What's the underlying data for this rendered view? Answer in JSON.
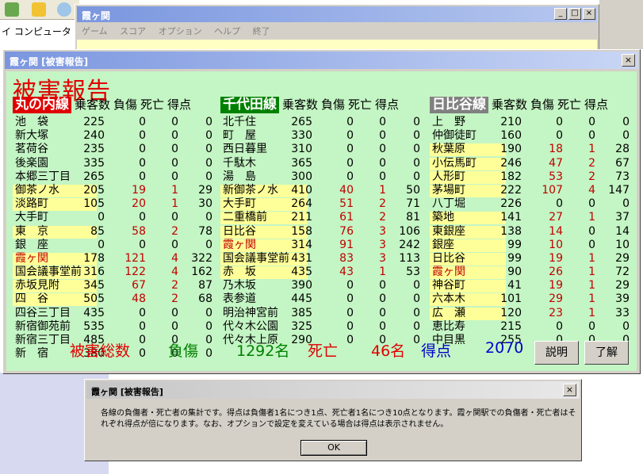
{
  "background": {
    "explorer_address": "イ コンピュータ",
    "game_title": "霞ヶ関",
    "game_menu": [
      "ゲーム",
      "スコア",
      "オプション",
      "ヘルプ",
      "終了"
    ],
    "window_buttons": {
      "minimize": "_",
      "maximize": "□",
      "close": "×"
    }
  },
  "dialog": {
    "title": "霞ヶ関 [被害報告]",
    "close": "×",
    "report_title": "被害報告",
    "column_headers": [
      "乗客数",
      "負傷",
      "死亡",
      "得点"
    ],
    "lines": [
      {
        "name": "丸の内線",
        "color": "#e00000",
        "stations": [
          {
            "name": "池　袋",
            "p": "225",
            "i": "0",
            "d": "0",
            "s": "0",
            "hl": false
          },
          {
            "name": "新大塚",
            "p": "240",
            "i": "0",
            "d": "0",
            "s": "0",
            "hl": false
          },
          {
            "name": "茗荷谷",
            "p": "235",
            "i": "0",
            "d": "0",
            "s": "0",
            "hl": false
          },
          {
            "name": "後楽園",
            "p": "335",
            "i": "0",
            "d": "0",
            "s": "0",
            "hl": false
          },
          {
            "name": "本郷三丁目",
            "p": "265",
            "i": "0",
            "d": "0",
            "s": "0",
            "hl": false
          },
          {
            "name": "御茶ノ水",
            "p": "205",
            "i": "19",
            "d": "1",
            "s": "29",
            "hl": true
          },
          {
            "name": "淡路町",
            "p": "105",
            "i": "20",
            "d": "1",
            "s": "30",
            "hl": true
          },
          {
            "name": "大手町",
            "p": "0",
            "i": "0",
            "d": "0",
            "s": "0",
            "hl": false
          },
          {
            "name": "東　京",
            "p": "85",
            "i": "58",
            "d": "2",
            "s": "78",
            "hl": true
          },
          {
            "name": "銀　座",
            "p": "0",
            "i": "0",
            "d": "0",
            "s": "0",
            "hl": false
          },
          {
            "name": "霞ヶ関",
            "p": "178",
            "i": "121",
            "d": "4",
            "s": "322",
            "hl": true,
            "red": true
          },
          {
            "name": "国会議事堂前",
            "p": "316",
            "i": "122",
            "d": "4",
            "s": "162",
            "hl": true
          },
          {
            "name": "赤坂見附",
            "p": "345",
            "i": "67",
            "d": "2",
            "s": "87",
            "hl": true
          },
          {
            "name": "四　谷",
            "p": "505",
            "i": "48",
            "d": "2",
            "s": "68",
            "hl": true
          },
          {
            "name": "四谷三丁目",
            "p": "435",
            "i": "0",
            "d": "0",
            "s": "0",
            "hl": false
          },
          {
            "name": "新宿御苑前",
            "p": "535",
            "i": "0",
            "d": "0",
            "s": "0",
            "hl": false
          },
          {
            "name": "新宿三丁目",
            "p": "485",
            "i": "0",
            "d": "0",
            "s": "0",
            "hl": false
          },
          {
            "name": "新　宿",
            "p": "380",
            "i": "0",
            "d": "0",
            "s": "0",
            "hl": false
          }
        ]
      },
      {
        "name": "千代田線",
        "color": "#008000",
        "stations": [
          {
            "name": "北千住",
            "p": "265",
            "i": "0",
            "d": "0",
            "s": "0",
            "hl": false
          },
          {
            "name": "町　屋",
            "p": "330",
            "i": "0",
            "d": "0",
            "s": "0",
            "hl": false
          },
          {
            "name": "西日暮里",
            "p": "310",
            "i": "0",
            "d": "0",
            "s": "0",
            "hl": false
          },
          {
            "name": "千駄木",
            "p": "365",
            "i": "0",
            "d": "0",
            "s": "0",
            "hl": false
          },
          {
            "name": "湯　島",
            "p": "300",
            "i": "0",
            "d": "0",
            "s": "0",
            "hl": false
          },
          {
            "name": "新御茶ノ水",
            "p": "410",
            "i": "40",
            "d": "1",
            "s": "50",
            "hl": true
          },
          {
            "name": "大手町",
            "p": "264",
            "i": "51",
            "d": "2",
            "s": "71",
            "hl": true
          },
          {
            "name": "二重橋前",
            "p": "211",
            "i": "61",
            "d": "2",
            "s": "81",
            "hl": true
          },
          {
            "name": "日比谷",
            "p": "158",
            "i": "76",
            "d": "3",
            "s": "106",
            "hl": true
          },
          {
            "name": "霞ヶ関",
            "p": "314",
            "i": "91",
            "d": "3",
            "s": "242",
            "hl": true,
            "red": true
          },
          {
            "name": "国会議事堂前",
            "p": "431",
            "i": "83",
            "d": "3",
            "s": "113",
            "hl": true
          },
          {
            "name": "赤　坂",
            "p": "435",
            "i": "43",
            "d": "1",
            "s": "53",
            "hl": true
          },
          {
            "name": "乃木坂",
            "p": "390",
            "i": "0",
            "d": "0",
            "s": "0",
            "hl": false
          },
          {
            "name": "表参道",
            "p": "445",
            "i": "0",
            "d": "0",
            "s": "0",
            "hl": false
          },
          {
            "name": "明治神宮前",
            "p": "385",
            "i": "0",
            "d": "0",
            "s": "0",
            "hl": false
          },
          {
            "name": "代々木公園",
            "p": "325",
            "i": "0",
            "d": "0",
            "s": "0",
            "hl": false
          },
          {
            "name": "代々木上原",
            "p": "290",
            "i": "0",
            "d": "0",
            "s": "0",
            "hl": false
          }
        ]
      },
      {
        "name": "日比谷線",
        "color": "#808080",
        "stations": [
          {
            "name": "上　野",
            "p": "210",
            "i": "0",
            "d": "0",
            "s": "0",
            "hl": false
          },
          {
            "name": "仲御徒町",
            "p": "160",
            "i": "0",
            "d": "0",
            "s": "0",
            "hl": false
          },
          {
            "name": "秋葉原",
            "p": "190",
            "i": "18",
            "d": "1",
            "s": "28",
            "hl": true
          },
          {
            "name": "小伝馬町",
            "p": "246",
            "i": "47",
            "d": "2",
            "s": "67",
            "hl": true
          },
          {
            "name": "人形町",
            "p": "182",
            "i": "53",
            "d": "2",
            "s": "73",
            "hl": true
          },
          {
            "name": "茅場町",
            "p": "222",
            "i": "107",
            "d": "4",
            "s": "147",
            "hl": true
          },
          {
            "name": "八丁堀",
            "p": "226",
            "i": "0",
            "d": "0",
            "s": "0",
            "hl": false
          },
          {
            "name": "築地",
            "p": "141",
            "i": "27",
            "d": "1",
            "s": "37",
            "hl": true
          },
          {
            "name": "東銀座",
            "p": "138",
            "i": "14",
            "d": "0",
            "s": "14",
            "hl": true
          },
          {
            "name": "銀座",
            "p": "99",
            "i": "10",
            "d": "0",
            "s": "10",
            "hl": true
          },
          {
            "name": "日比谷",
            "p": "99",
            "i": "19",
            "d": "1",
            "s": "29",
            "hl": true
          },
          {
            "name": "霞ヶ関",
            "p": "90",
            "i": "26",
            "d": "1",
            "s": "72",
            "hl": true,
            "red": true
          },
          {
            "name": "神谷町",
            "p": "41",
            "i": "19",
            "d": "1",
            "s": "29",
            "hl": true
          },
          {
            "name": "六本木",
            "p": "101",
            "i": "29",
            "d": "1",
            "s": "39",
            "hl": true
          },
          {
            "name": "広　瀬",
            "p": "120",
            "i": "23",
            "d": "1",
            "s": "33",
            "hl": true
          },
          {
            "name": "恵比寿",
            "p": "215",
            "i": "0",
            "d": "0",
            "s": "0",
            "hl": false
          },
          {
            "name": "中目黒",
            "p": "255",
            "i": "0",
            "d": "0",
            "s": "0",
            "hl": false
          }
        ]
      }
    ],
    "totals": {
      "label": "被害総数",
      "injured_label": "負傷",
      "injured_value": "1292名",
      "dead_label": "死亡",
      "dead_value": "46名",
      "score_label": "得点",
      "score_value": "2070"
    },
    "buttons": {
      "explain": "説明",
      "ok": "了解"
    }
  },
  "info": {
    "title": "霞ヶ関 [被害報告]",
    "close": "×",
    "message": "各線の負傷者・死亡者の集計です。得点は負傷者1名につき1点、死亡者1名につき10点となります。霞ヶ関駅での負傷者・死亡者はそれぞれ得点が倍になります。なお、オプションで設定を変えている場合は得点は表示されません。",
    "ok": "OK"
  },
  "colors": {
    "injured": "#c00000",
    "zero": "#000000",
    "body": "#c4f5c4",
    "highlight": "#ffff99"
  }
}
